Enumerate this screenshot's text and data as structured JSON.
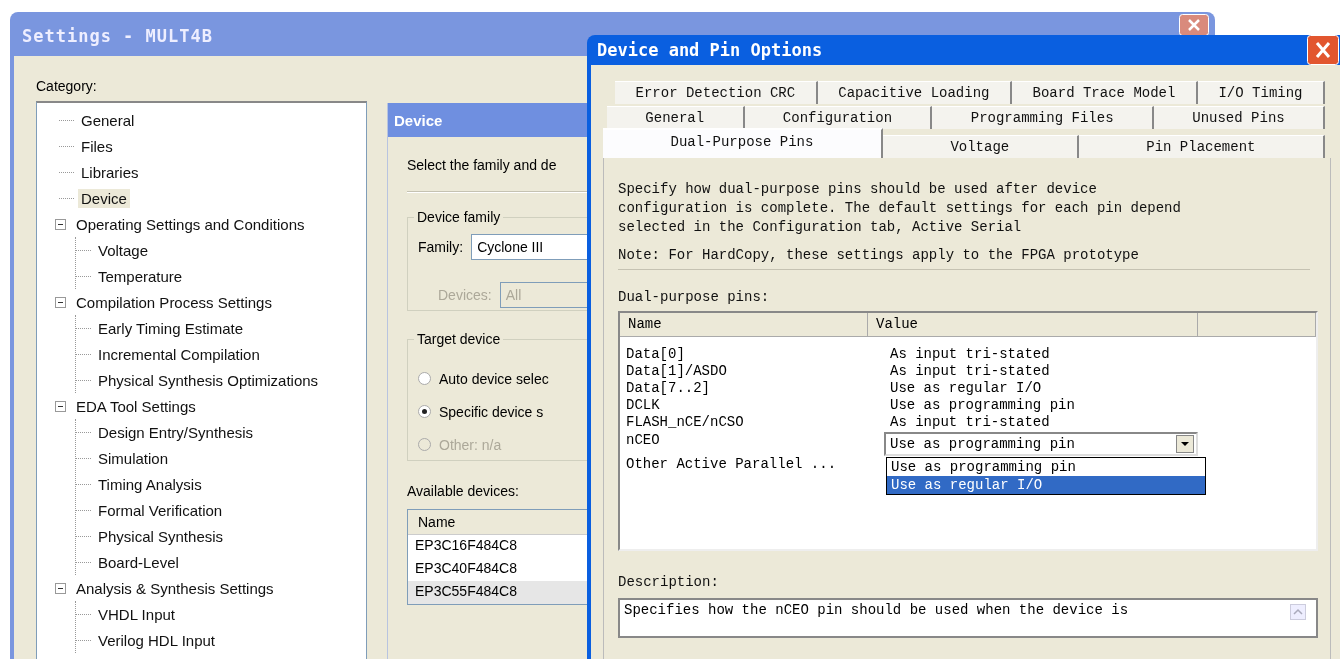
{
  "settings_window": {
    "title": "Settings - MULT4B",
    "category_label": "Category:",
    "tree": [
      {
        "label": "General",
        "selected": false
      },
      {
        "label": "Files",
        "selected": false
      },
      {
        "label": "Libraries",
        "selected": false
      },
      {
        "label": "Device",
        "selected": true
      },
      {
        "label": "Operating Settings and Conditions",
        "selected": false,
        "expanded": true,
        "children": [
          {
            "label": "Voltage",
            "selected": false
          },
          {
            "label": "Temperature",
            "selected": false
          }
        ]
      },
      {
        "label": "Compilation Process Settings",
        "selected": false,
        "expanded": true,
        "children": [
          {
            "label": "Early Timing Estimate",
            "selected": false
          },
          {
            "label": "Incremental Compilation",
            "selected": false
          },
          {
            "label": "Physical Synthesis Optimizations",
            "selected": false
          }
        ]
      },
      {
        "label": "EDA Tool Settings",
        "selected": false,
        "expanded": true,
        "children": [
          {
            "label": "Design Entry/Synthesis",
            "selected": false
          },
          {
            "label": "Simulation",
            "selected": false
          },
          {
            "label": "Timing Analysis",
            "selected": false
          },
          {
            "label": "Formal Verification",
            "selected": false
          },
          {
            "label": "Physical Synthesis",
            "selected": false
          },
          {
            "label": "Board-Level",
            "selected": false
          }
        ]
      },
      {
        "label": "Analysis & Synthesis Settings",
        "selected": false,
        "expanded": true,
        "children": [
          {
            "label": "VHDL Input",
            "selected": false
          },
          {
            "label": "Verilog HDL Input",
            "selected": false
          }
        ]
      }
    ],
    "device_panel": {
      "header": "Device",
      "intro": "Select the family and de",
      "device_family": {
        "legend": "Device family",
        "family_label": "Family:",
        "family_value": "Cyclone III",
        "devices_label": "Devices:",
        "devices_value": "All",
        "devices_disabled": true
      },
      "target_device": {
        "legend": "Target device",
        "options": [
          {
            "label": "Auto device selec",
            "selected": false,
            "disabled": false
          },
          {
            "label": "Specific device s",
            "selected": true,
            "disabled": false
          },
          {
            "label": "Other: n/a",
            "selected": false,
            "disabled": true
          }
        ]
      },
      "available_label": "Available devices:",
      "devices_table": {
        "columns": [
          "Name"
        ],
        "rows": [
          {
            "name": "EP3C16F484C8",
            "selected": false
          },
          {
            "name": "EP3C40F484C8",
            "selected": false
          },
          {
            "name": "EP3C55F484C8",
            "selected": true
          }
        ]
      }
    }
  },
  "dialog": {
    "title": "Device and Pin Options",
    "tab_rows": [
      [
        {
          "label": "Error Detection CRC",
          "selected": false
        },
        {
          "label": "Capacitive Loading",
          "selected": false
        },
        {
          "label": "Board Trace Model",
          "selected": false
        },
        {
          "label": "I/O Timing",
          "selected": false
        }
      ],
      [
        {
          "label": "General",
          "selected": false
        },
        {
          "label": "Configuration",
          "selected": false
        },
        {
          "label": "Programming Files",
          "selected": false
        },
        {
          "label": "Unused Pins",
          "selected": false
        }
      ],
      [
        {
          "label": "Dual-Purpose Pins",
          "selected": true
        },
        {
          "label": "Voltage",
          "selected": false
        },
        {
          "label": "Pin Placement",
          "selected": false
        }
      ]
    ],
    "intro": "Specify how dual-purpose pins should be used after device\nconfiguration is complete. The default settings for each pin depend\nselected in the Configuration tab,  Active Serial",
    "note": "Note: For HardCopy, these settings apply to the FPGA prototype",
    "pins_label": "Dual-purpose pins:",
    "pins_table": {
      "columns": [
        "Name",
        "Value"
      ],
      "rows": [
        {
          "name": "Data[0]",
          "value": "As input tri-stated",
          "kind": "text"
        },
        {
          "name": "Data[1]/ASDO",
          "value": "As input tri-stated",
          "kind": "text"
        },
        {
          "name": "Data[7..2]",
          "value": "Use as regular I/O",
          "kind": "text"
        },
        {
          "name": "DCLK",
          "value": "Use as programming pin",
          "kind": "text"
        },
        {
          "name": "FLASH_nCE/nCSO",
          "value": "As input tri-stated",
          "kind": "text"
        },
        {
          "name": "nCEO",
          "value": "Use as programming pin",
          "kind": "dropdown"
        },
        {
          "name": "Other Active Parallel ...",
          "kind": "text"
        }
      ],
      "dropdown_options": [
        {
          "label": "Use as programming pin",
          "selected": false
        },
        {
          "label": "Use as regular I/O",
          "selected": true
        }
      ]
    },
    "description_label": "Description:",
    "description": "Specifies how the nCEO pin should be used when the device is"
  }
}
